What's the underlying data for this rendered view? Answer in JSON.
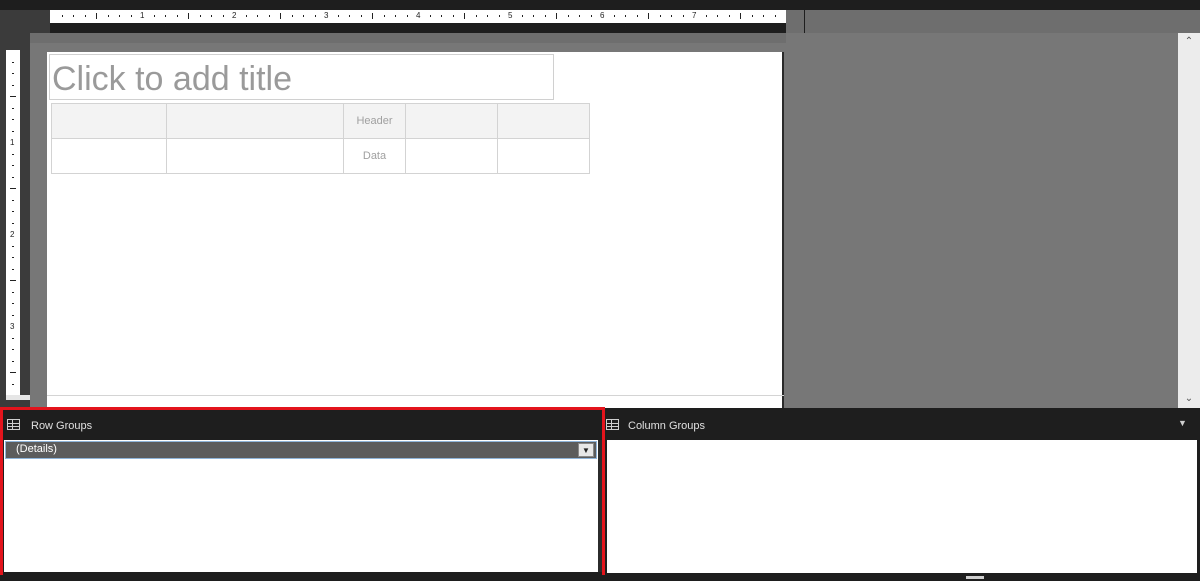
{
  "ruler": {
    "horizontal_numbers": [
      "1",
      "2",
      "3",
      "4",
      "5",
      "6",
      "7"
    ],
    "vertical_numbers": [
      "1",
      "2",
      "3"
    ]
  },
  "report": {
    "title_placeholder": "Click to add title",
    "table": {
      "header_row": [
        "",
        "",
        "Header",
        "",
        ""
      ],
      "data_row": [
        "",
        "",
        "Data",
        "",
        ""
      ]
    }
  },
  "row_groups": {
    "title": "Row Groups",
    "icon": "table-grid-icon",
    "items": [
      {
        "label": "(Details)"
      }
    ],
    "dropdown_icon": "▼",
    "highlight_color": "#e3141c"
  },
  "column_groups": {
    "title": "Column Groups",
    "icon": "table-grid-icon",
    "menu_icon": "▼"
  },
  "scrollbar": {
    "up_icon": "⌃",
    "down_icon": "⌄"
  }
}
